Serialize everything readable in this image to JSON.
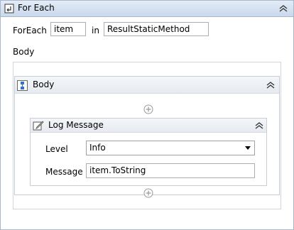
{
  "activity": {
    "title": "For Each",
    "foreach_label": "ForEach",
    "item_value": "item",
    "in_label": "in",
    "collection_value": "ResultStaticMethod",
    "body_label": "Body"
  },
  "sequence": {
    "title": "Body"
  },
  "log_message": {
    "title": "Log Message",
    "level_label": "Level",
    "level_value": "Info",
    "message_label": "Message",
    "message_value": "item.ToString"
  }
}
